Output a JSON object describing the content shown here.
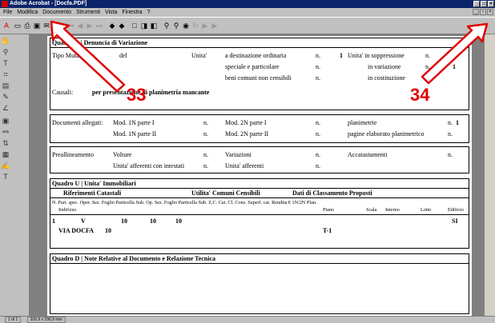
{
  "window": {
    "title": "Adobe Acrobat - [Docfa.PDF]"
  },
  "menu": [
    "File",
    "Modifica",
    "Documento",
    "Strumenti",
    "Vista",
    "Finestra",
    "?"
  ],
  "quadro_b": {
    "header": "Quadro B | Denuncia di Variazione",
    "tipo_mutazione": "Tipo Mutazione:",
    "del": "del",
    "unita": "Unita'",
    "dest_ordinaria": "a destinazione ordinaria",
    "n": "n.",
    "n1": "1",
    "unita_soppressione": "Unita' in soppressione",
    "speciale": "speciale e particolare",
    "in_variazione": "in variazione",
    "in_variazione_n": "1",
    "beni_comuni": "beni comuni non censibili",
    "in_costituzione": "in costituzione",
    "causali": "Causali:",
    "causali_value": "per presentazione di planimetria mancante"
  },
  "allegati": {
    "label": "Documenti allegati:",
    "mod1n_i": "Mod. 1N parte I",
    "mod2n_i": "Mod. 2N parte I",
    "planimetrie": "planimetrie",
    "planimetrie_n": "1",
    "mod1n_ii": "Mod. 1N parte II",
    "mod2n_ii": "Mod. 2N parte II",
    "pagine": "pagine elaborato planimetrico"
  },
  "preall": {
    "label": "Preallineamento",
    "volture": "Volture",
    "variazioni": "Variazioni",
    "accatastamenti": "Accatastamenti",
    "unita_intestati": "Unita' afferenti con intestati",
    "unita_afferenti": "Unita' afferenti"
  },
  "quadro_u": {
    "header": "Quadro U | Unita' Immobiliari",
    "rif": "Riferimenti Catastali",
    "utilita": "Utilita' Comuni Censibili",
    "dati": "Dati di Classamento Proposti",
    "cols1": "N. Part. spec. Oper. Sez. Foglio Particella Sub. Op. Sez. Foglio Particella Sub. Z.C. Cat. Cl. Cons. Superf. cat. Rendita € 1N/2N Plan.",
    "indirizzo": "Indirizzo",
    "piano": "Piano",
    "scala": "Scala",
    "interno": "Interno",
    "lotto": "Lotto",
    "edificio": "Edificio",
    "row_n": "1",
    "row_v": "V",
    "row_foglio": "10",
    "row_part": "10",
    "row_sub": "10",
    "row_si": "SI",
    "row_via": "VIA DOCFA",
    "row_civ": "10",
    "row_piano": "T-1"
  },
  "quadro_d": {
    "header": "Quadro D | Note Relative al Documento e Relazione Tecnica"
  },
  "callouts": {
    "c33": "33",
    "c34": "34"
  },
  "status": {
    "page": "1 di 1",
    "size": "209,9 x 296,9 mm"
  },
  "colors": {
    "callout": "#e00000",
    "titlebar": "#0a246a"
  }
}
